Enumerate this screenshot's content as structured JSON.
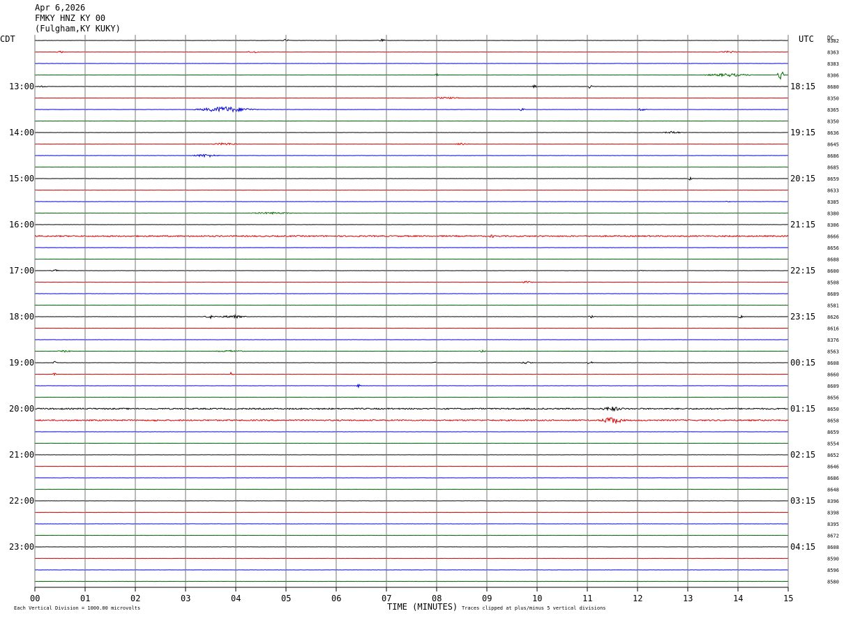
{
  "header": {
    "date": "Apr 6,2026",
    "station": "FMKY HNZ KY 00",
    "location": "(Fulgham,KY KUKY)"
  },
  "labels": {
    "left_tz": "CDT",
    "right_tz": "UTC",
    "dc": "DC",
    "xlabel": "TIME (MINUTES)",
    "scale_note": "Each Vertical Division = 1000.00 microvolts",
    "clip_note": "Traces clipped at plus/minus 5 vertical divisions"
  },
  "chart_data": {
    "type": "line",
    "title": "FMKY HNZ KY 00",
    "xlabel": "TIME (MINUTES)",
    "xlim": [
      0,
      15
    ],
    "x_ticks": [
      "00",
      "01",
      "02",
      "03",
      "04",
      "05",
      "06",
      "07",
      "08",
      "09",
      "10",
      "11",
      "12",
      "13",
      "14",
      "15"
    ],
    "trace_count": 48,
    "trace_minutes": 15,
    "trace_colors": [
      "#000000",
      "#dd0000",
      "#0000dd",
      "#006600"
    ],
    "left_hour_labels": [
      "13:00",
      "14:00",
      "15:00",
      "16:00",
      "17:00",
      "18:00",
      "19:00",
      "20:00",
      "21:00",
      "22:00",
      "23:00"
    ],
    "right_hour_labels": [
      "18:15",
      "19:15",
      "20:15",
      "21:15",
      "22:15",
      "23:15",
      "00:15",
      "01:15",
      "02:15",
      "03:15",
      "04:15"
    ],
    "hour_label_first_row": 4,
    "hour_label_every": 4,
    "dc_offsets": [
      "8382",
      "8363",
      "8383",
      "8306",
      "8680",
      "8350",
      "8365",
      "8350",
      "8636",
      "8645",
      "8686",
      "8685",
      "8659",
      "8633",
      "8385",
      "8380",
      "8306",
      "8666",
      "8656",
      "8688",
      "8600",
      "8508",
      "8689",
      "8581",
      "8626",
      "8616",
      "8376",
      "8563",
      "8608",
      "8660",
      "8609",
      "8656",
      "8650",
      "8658",
      "8659",
      "8554",
      "8652",
      "8646",
      "8686",
      "8648",
      "8396",
      "8398",
      "8395",
      "8672",
      "8608",
      "8590",
      "8596",
      "8580"
    ],
    "events": [
      {
        "row": 0,
        "minute": 5.0,
        "width": 0.15,
        "amp": 2
      },
      {
        "row": 0,
        "minute": 6.9,
        "width": 0.2,
        "amp": 1.5
      },
      {
        "row": 1,
        "minute": 0.5,
        "width": 0.15,
        "amp": 1.5
      },
      {
        "row": 1,
        "minute": 4.35,
        "width": 0.25,
        "amp": 1.5
      },
      {
        "row": 1,
        "minute": 13.8,
        "width": 0.5,
        "amp": 1
      },
      {
        "row": 3,
        "minute": 8.0,
        "width": 0.1,
        "amp": 2
      },
      {
        "row": 3,
        "minute": 13.8,
        "width": 1.0,
        "amp": 2
      },
      {
        "row": 3,
        "minute": 14.85,
        "width": 0.15,
        "amp": 8
      },
      {
        "row": 4,
        "minute": 0.15,
        "width": 0.2,
        "amp": 1.5
      },
      {
        "row": 4,
        "minute": 9.95,
        "width": 0.1,
        "amp": 2
      },
      {
        "row": 4,
        "minute": 11.05,
        "width": 0.1,
        "amp": 3
      },
      {
        "row": 5,
        "minute": 8.2,
        "width": 0.6,
        "amp": 1
      },
      {
        "row": 6,
        "minute": 3.8,
        "width": 1.3,
        "amp": 4
      },
      {
        "row": 6,
        "minute": 9.7,
        "width": 0.15,
        "amp": 2
      },
      {
        "row": 6,
        "minute": 12.1,
        "width": 0.2,
        "amp": 2
      },
      {
        "row": 8,
        "minute": 12.7,
        "width": 0.4,
        "amp": 1.5
      },
      {
        "row": 9,
        "minute": 3.8,
        "width": 0.6,
        "amp": 1.5
      },
      {
        "row": 9,
        "minute": 8.5,
        "width": 0.3,
        "amp": 1
      },
      {
        "row": 10,
        "minute": 3.4,
        "width": 0.6,
        "amp": 2
      },
      {
        "row": 12,
        "minute": 13.05,
        "width": 0.1,
        "amp": 2
      },
      {
        "row": 14,
        "minute": 13.8,
        "width": 0.1,
        "amp": 1.5
      },
      {
        "row": 15,
        "minute": 4.7,
        "width": 0.9,
        "amp": 1
      },
      {
        "row": 17,
        "minute": 9.1,
        "width": 0.2,
        "amp": 2
      },
      {
        "row": 20,
        "minute": 0.4,
        "width": 0.2,
        "amp": 1.5
      },
      {
        "row": 20,
        "minute": 12.1,
        "width": 0.15,
        "amp": 1.5
      },
      {
        "row": 21,
        "minute": 9.8,
        "width": 0.3,
        "amp": 1
      },
      {
        "row": 24,
        "minute": 3.5,
        "width": 0.3,
        "amp": 2
      },
      {
        "row": 24,
        "minute": 3.95,
        "width": 0.55,
        "amp": 2
      },
      {
        "row": 24,
        "minute": 11.1,
        "width": 0.15,
        "amp": 2
      },
      {
        "row": 24,
        "minute": 14.05,
        "width": 0.1,
        "amp": 2
      },
      {
        "row": 27,
        "minute": 0.6,
        "width": 0.3,
        "amp": 1
      },
      {
        "row": 27,
        "minute": 3.9,
        "width": 0.6,
        "amp": 1
      },
      {
        "row": 27,
        "minute": 8.9,
        "width": 0.15,
        "amp": 1.5
      },
      {
        "row": 28,
        "minute": 0.4,
        "width": 0.1,
        "amp": 3
      },
      {
        "row": 28,
        "minute": 7.95,
        "width": 0.1,
        "amp": 1.5
      },
      {
        "row": 28,
        "minute": 9.8,
        "width": 0.3,
        "amp": 1.5
      },
      {
        "row": 28,
        "minute": 11.05,
        "width": 0.15,
        "amp": 2
      },
      {
        "row": 29,
        "minute": 0.4,
        "width": 0.1,
        "amp": 2
      },
      {
        "row": 29,
        "minute": 3.9,
        "width": 0.1,
        "amp": 2.5
      },
      {
        "row": 30,
        "minute": 6.45,
        "width": 0.1,
        "amp": 2
      },
      {
        "row": 32,
        "minute": 11.5,
        "width": 0.6,
        "amp": 3
      },
      {
        "row": 33,
        "minute": 11.5,
        "width": 0.6,
        "amp": 5
      },
      {
        "row": 33,
        "minute": 2.4,
        "width": 0.1,
        "amp": 2
      }
    ],
    "noisy_rows": [
      17,
      32,
      33
    ]
  }
}
